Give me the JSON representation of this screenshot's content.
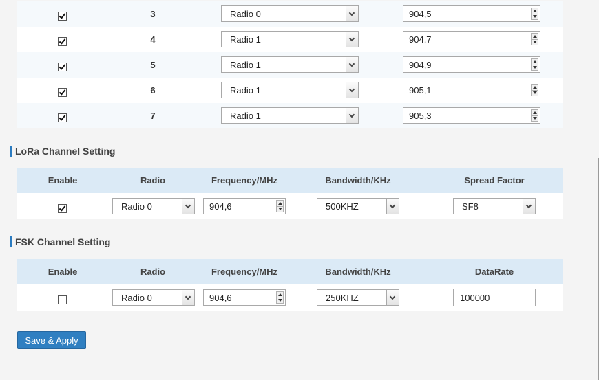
{
  "multi_channels": [
    {
      "enabled": true,
      "index": "3",
      "radio": "Radio 0",
      "frequency": "904,5"
    },
    {
      "enabled": true,
      "index": "4",
      "radio": "Radio 1",
      "frequency": "904,7"
    },
    {
      "enabled": true,
      "index": "5",
      "radio": "Radio 1",
      "frequency": "904,9"
    },
    {
      "enabled": true,
      "index": "6",
      "radio": "Radio 1",
      "frequency": "905,1"
    },
    {
      "enabled": true,
      "index": "7",
      "radio": "Radio 1",
      "frequency": "905,3"
    }
  ],
  "lora": {
    "title": "LoRa Channel Setting",
    "headers": [
      "Enable",
      "Radio",
      "Frequency/MHz",
      "Bandwidth/KHz",
      "Spread Factor"
    ],
    "row": {
      "enabled": true,
      "radio": "Radio 0",
      "frequency": "904,6",
      "bandwidth": "500KHZ",
      "spread_factor": "SF8"
    }
  },
  "fsk": {
    "title": "FSK Channel Setting",
    "headers": [
      "Enable",
      "Radio",
      "Frequency/MHz",
      "Bandwidth/KHz",
      "DataRate"
    ],
    "row": {
      "enabled": false,
      "radio": "Radio 0",
      "frequency": "904,6",
      "bandwidth": "250KHZ",
      "datarate": "100000"
    }
  },
  "actions": {
    "save_apply": "Save & Apply"
  },
  "colors": {
    "accent": "#2f7fc1",
    "header_bg": "#dbeaf6",
    "section_bar": "#2b7bc0"
  }
}
